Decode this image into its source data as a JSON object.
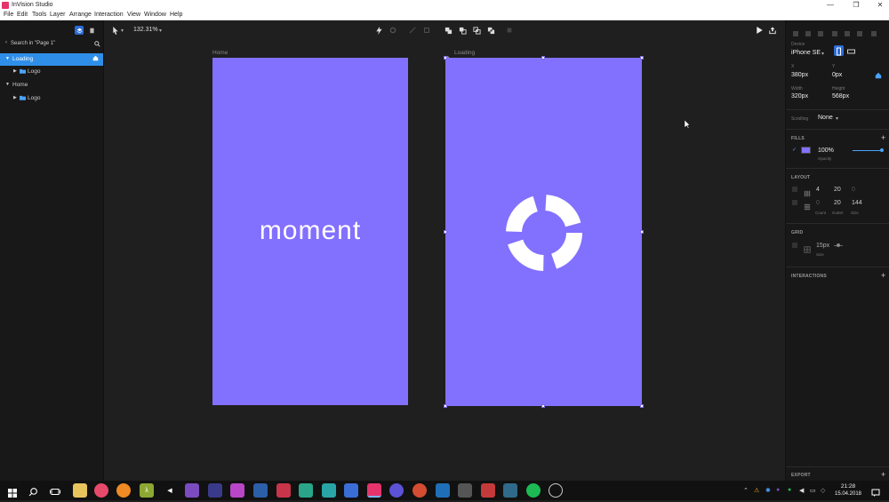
{
  "window": {
    "title": "InVision Studio",
    "controls": {
      "minimize": "—",
      "maximize": "❐",
      "close": "✕"
    }
  },
  "menu": [
    "File",
    "Edit",
    "Tools",
    "Layer",
    "Arrange",
    "Interaction",
    "View",
    "Window",
    "Help"
  ],
  "left_panel": {
    "search_label": "Search in \"Page 1\"",
    "layers": [
      {
        "label": "Loading",
        "indent": 0,
        "expanded": true,
        "selected": true
      },
      {
        "label": "Logo",
        "indent": 1,
        "expanded": false,
        "selected": false
      },
      {
        "label": "Home",
        "indent": 0,
        "expanded": true,
        "selected": false
      },
      {
        "label": "Logo",
        "indent": 1,
        "expanded": false,
        "selected": false
      }
    ]
  },
  "toolbar": {
    "zoom": "132.31%"
  },
  "canvas": {
    "artboards": [
      {
        "label": "Home",
        "logo_text": "moment"
      },
      {
        "label": "Loading"
      }
    ],
    "artboard_color": "#8270ff"
  },
  "right_panel": {
    "device_label": "Device",
    "device_value": "iPhone SE",
    "x_label": "X",
    "x_value": "380px",
    "y_label": "Y",
    "y_value": "0px",
    "width_label": "Width",
    "width_value": "320px",
    "height_label": "Height",
    "height_value": "568px",
    "scrolling_label": "Scrolling",
    "scrolling_value": "None",
    "fills_title": "FILLS",
    "fill_opacity": "100%",
    "opacity_label": "Opacity",
    "layout_title": "LAYOUT",
    "layout_row1": {
      "count": "4",
      "gutter": "20",
      "size": "0"
    },
    "layout_row2": {
      "count": "0",
      "gutter": "20",
      "size": "144"
    },
    "count_label": "Count",
    "gutter_label": "Gutter",
    "size_label": "Size",
    "grid_title": "GRID",
    "grid_size": "15px",
    "grid_size_label": "Size",
    "interactions_title": "INTERACTIONS",
    "export_title": "EXPORT"
  },
  "taskbar": {
    "time": "21:28",
    "date": "15.04.2018"
  }
}
